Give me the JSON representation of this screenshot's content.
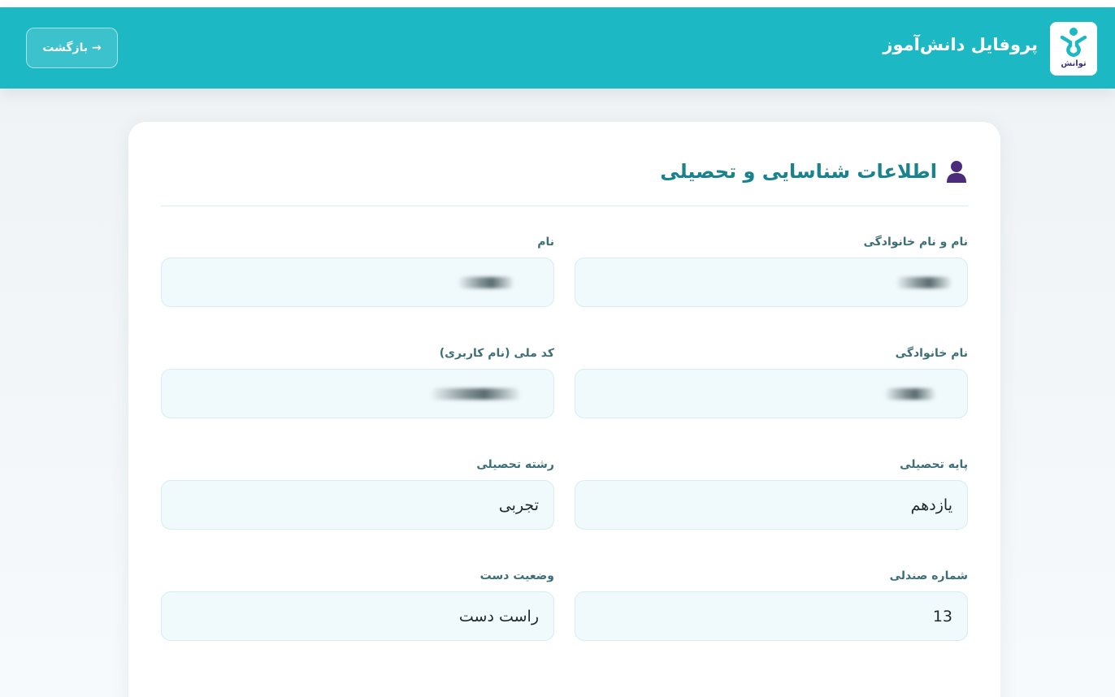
{
  "header": {
    "title": "پروفایل دانش‌آموز",
    "back_label": "→ بازگشت",
    "logo_text": "توانش"
  },
  "colors": {
    "header_bg": "#1cb8c4",
    "title_color": "#18838f",
    "field_bg": "#f0f9fb",
    "icon_color": "#4a2c7a"
  },
  "section": {
    "title": "اطلاعات شناسایی و تحصیلی",
    "icon": "user-icon"
  },
  "fields": {
    "full_name": {
      "label": "نام و نام خانوادگی",
      "value": ""
    },
    "first_name": {
      "label": "نام",
      "value": ""
    },
    "last_name": {
      "label": "نام خانوادگی",
      "value": ""
    },
    "national_code": {
      "label": "کد ملی (نام کاربری)",
      "value": ""
    },
    "grade": {
      "label": "پایه تحصیلی",
      "value": "یازدهم"
    },
    "major": {
      "label": "رشته تحصیلی",
      "value": "تجربی"
    },
    "seat_number": {
      "label": "شماره صندلی",
      "value": "13"
    },
    "handedness": {
      "label": "وضعیت دست",
      "value": "راست دست"
    }
  }
}
